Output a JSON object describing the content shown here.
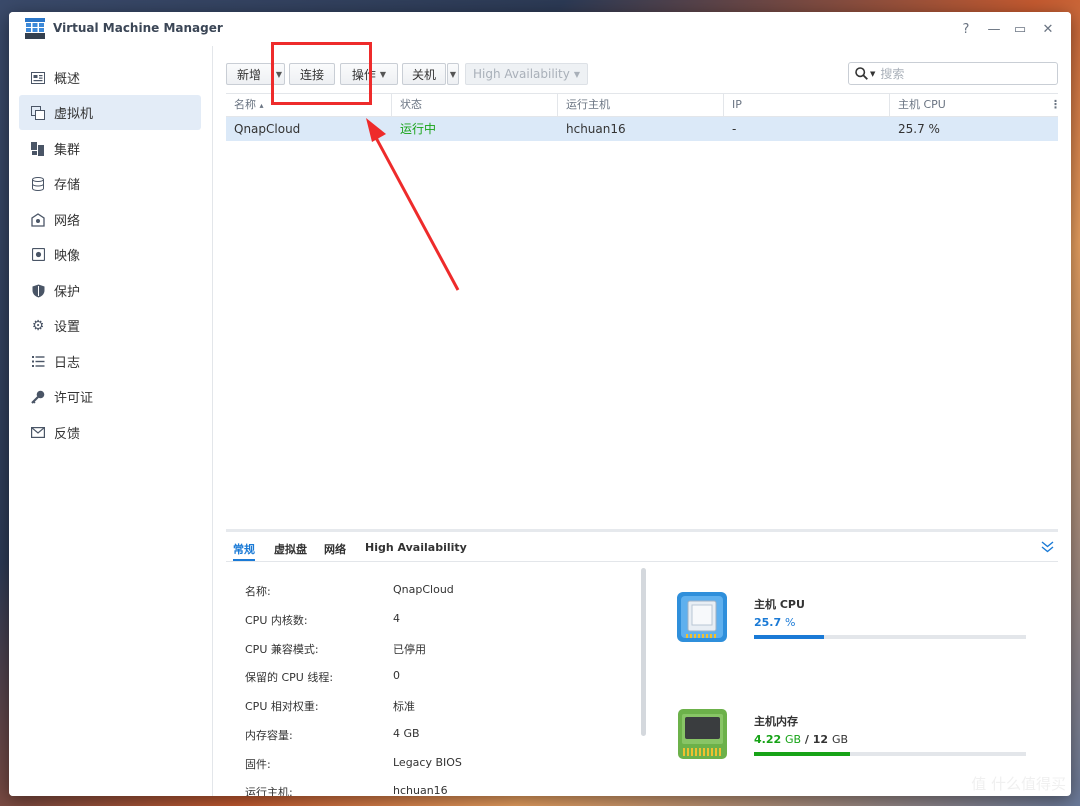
{
  "window": {
    "title": "Virtual Machine Manager",
    "controls": {
      "help": "?",
      "minimize": "—",
      "maximize": "▭",
      "close": "✕"
    }
  },
  "sidebar": {
    "items": [
      {
        "label": "概述",
        "icon": "overview-icon"
      },
      {
        "label": "虚拟机",
        "icon": "vm-icon",
        "active": true
      },
      {
        "label": "集群",
        "icon": "cluster-icon"
      },
      {
        "label": "存储",
        "icon": "storage-icon"
      },
      {
        "label": "网络",
        "icon": "network-icon"
      },
      {
        "label": "映像",
        "icon": "image-icon"
      },
      {
        "label": "保护",
        "icon": "shield-icon"
      },
      {
        "label": "设置",
        "icon": "gear-icon"
      },
      {
        "label": "日志",
        "icon": "list-icon"
      },
      {
        "label": "许可证",
        "icon": "key-icon"
      },
      {
        "label": "反馈",
        "icon": "mail-icon"
      }
    ]
  },
  "toolbar": {
    "new_label": "新增",
    "connect_label": "连接",
    "action_label": "操作",
    "shutdown_label": "关机",
    "ha_label": "High Availability",
    "search_placeholder": "搜索"
  },
  "grid": {
    "columns": [
      "名称",
      "状态",
      "运行主机",
      "IP",
      "主机 CPU"
    ],
    "sort_indicator": "▴",
    "rows": [
      {
        "name": "QnapCloud",
        "status": "运行中",
        "host": "hchuan16",
        "ip": "-",
        "cpu": "25.7 %"
      }
    ]
  },
  "detail": {
    "tabs": [
      "常规",
      "虚拟盘",
      "网络",
      "High Availability"
    ],
    "properties": [
      {
        "label": "名称:",
        "value": "QnapCloud"
      },
      {
        "label": "CPU 内核数:",
        "value": "4"
      },
      {
        "label": "CPU 兼容模式:",
        "value": "已停用"
      },
      {
        "label": "保留的 CPU 线程:",
        "value": "0"
      },
      {
        "label": "CPU 相对权重:",
        "value": "标准"
      },
      {
        "label": "内存容量:",
        "value": "4 GB"
      },
      {
        "label": "固件:",
        "value": "Legacy BIOS"
      },
      {
        "label": "运行主机:",
        "value": "hchuan16"
      }
    ],
    "cpu": {
      "title": "主机 CPU",
      "value": "25.7",
      "unit": "%",
      "percent": 25.7,
      "color": "#1a7ad6"
    },
    "memory": {
      "title": "主机内存",
      "used": "4.22",
      "used_unit": "GB",
      "separator": "/",
      "total": "12",
      "total_unit": "GB",
      "fraction": 0.352,
      "color": "#17a317"
    }
  },
  "watermark": "值 什么值得买",
  "colors": {
    "accent": "#1a7ad6",
    "running": "#17a317",
    "annotation": "#ee2b2b"
  }
}
